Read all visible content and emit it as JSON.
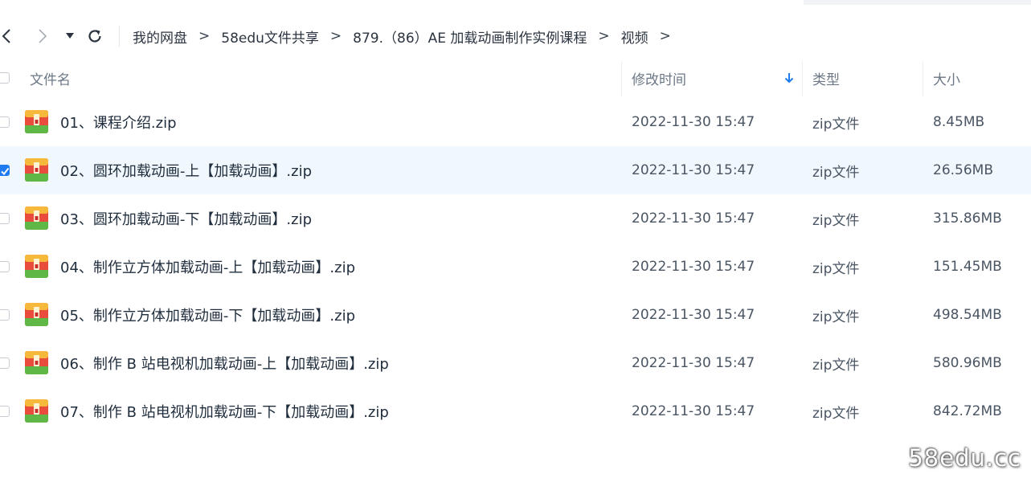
{
  "nav": {
    "back_icon": "chevron-left-icon",
    "forward_icon": "chevron-right-icon",
    "dropdown_icon": "caret-down-icon",
    "refresh_icon": "refresh-icon"
  },
  "breadcrumb": {
    "items": [
      "我的网盘",
      "58edu文件共享",
      "879.（86）AE 加载动画制作实例课程",
      "视频"
    ],
    "separator": ">"
  },
  "columns": {
    "name": "文件名",
    "modified": "修改时间",
    "type": "类型",
    "size": "大小",
    "sort_icon": "arrow-down-icon",
    "sort_color": "#1e7bf0"
  },
  "files": [
    {
      "name": "01、课程介绍.zip",
      "modified": "2022-11-30 15:47",
      "type": "zip文件",
      "size": "8.45MB",
      "checked": false
    },
    {
      "name": "02、圆环加载动画-上【加载动画】.zip",
      "modified": "2022-11-30 15:47",
      "type": "zip文件",
      "size": "26.56MB",
      "checked": true
    },
    {
      "name": "03、圆环加载动画-下【加载动画】.zip",
      "modified": "2022-11-30 15:47",
      "type": "zip文件",
      "size": "315.86MB",
      "checked": false
    },
    {
      "name": "04、制作立方体加载动画-上【加载动画】.zip",
      "modified": "2022-11-30 15:47",
      "type": "zip文件",
      "size": "151.45MB",
      "checked": false
    },
    {
      "name": "05、制作立方体加载动画-下【加载动画】.zip",
      "modified": "2022-11-30 15:47",
      "type": "zip文件",
      "size": "498.54MB",
      "checked": false
    },
    {
      "name": "06、制作 B 站电视机加载动画-上【加载动画】.zip",
      "modified": "2022-11-30 15:47",
      "type": "zip文件",
      "size": "580.96MB",
      "checked": false
    },
    {
      "name": "07、制作 B 站电视机加载动画-下【加载动画】.zip",
      "modified": "2022-11-30 15:47",
      "type": "zip文件",
      "size": "842.72MB",
      "checked": false
    }
  ],
  "file_icon": "zip-archive-icon",
  "watermark": "58edu.cc"
}
